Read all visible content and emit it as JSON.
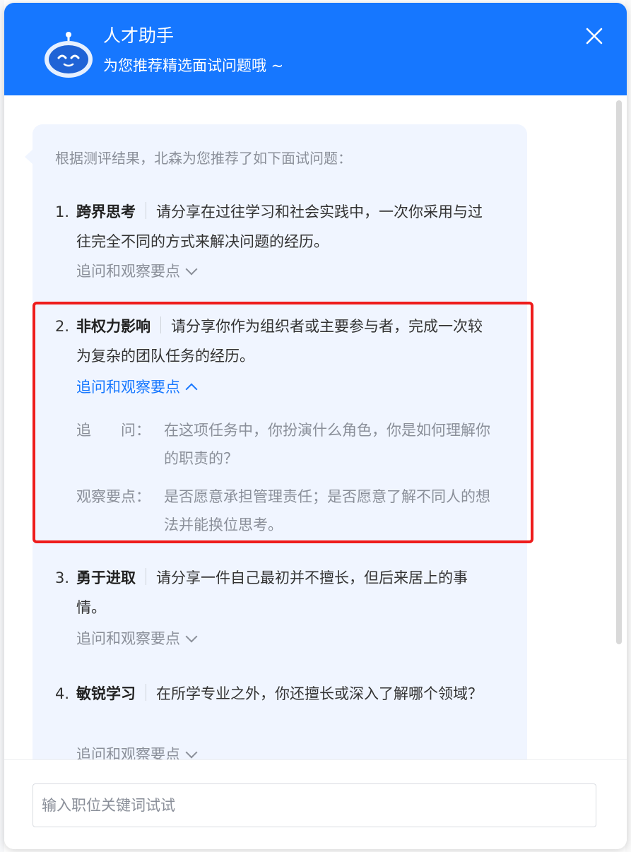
{
  "header": {
    "title": "人才助手",
    "subtitle": "为您推荐精选面试问题哦 ~",
    "accent": "#1677ff"
  },
  "chat": {
    "intro": "根据测评结果，北森为您推荐了如下面试问题：",
    "toggle_label": "追问和观察要点",
    "questions": [
      {
        "num": "1.",
        "name": "跨界思考",
        "text": "请分享在过往学习和社会实践中，一次你采用与过往完全不同的方式来解决问题的经历。",
        "expanded": false
      },
      {
        "num": "2.",
        "name": "非权力影响",
        "text": "请分享你作为组织者或主要参与者，完成一次较为复杂的团队任务的经历。",
        "expanded": true,
        "followup_label": "追　　问：",
        "followup": "在这项任务中，你扮演什么角色，你是如何理解你的职责的？",
        "observe_label": "观察要点：",
        "observe": "是否愿意承担管理责任；是否愿意了解不同人的想法并能换位思考。"
      },
      {
        "num": "3.",
        "name": "勇于进取",
        "text": "请分享一件自己最初并不擅长，但后来居上的事情。",
        "expanded": false
      },
      {
        "num": "4.",
        "name": "敏锐学习",
        "text": "在所学专业之外，你还擅长或深入了解哪个领域？",
        "expanded": false
      }
    ]
  },
  "footer": {
    "input_placeholder": "输入职位关键词试试",
    "input_value": ""
  },
  "colors": {
    "highlight_border": "#ee1c1c",
    "bubble_bg": "#f0f5ff"
  }
}
